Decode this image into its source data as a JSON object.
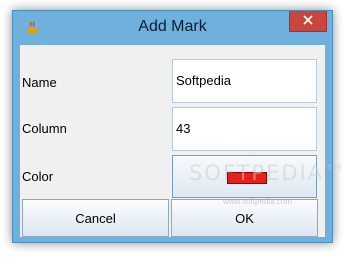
{
  "window": {
    "title": "Add Mark",
    "close_label": "✕"
  },
  "form": {
    "name_label": "Name",
    "name_value": "Softpedia",
    "column_label": "Column",
    "column_value": "43",
    "color_label": "Color",
    "color_value": "#e8201c"
  },
  "buttons": {
    "cancel_label": "Cancel",
    "ok_label": "OK"
  },
  "watermark": {
    "text": "SOFTPEDIA™",
    "url": "www.softpedia.com"
  },
  "colors": {
    "titlebar": "#6fb0dd",
    "close": "#c9463d",
    "swatch": "#e8201c"
  },
  "icons": {
    "app": "java-cup-icon",
    "close": "close-icon"
  }
}
